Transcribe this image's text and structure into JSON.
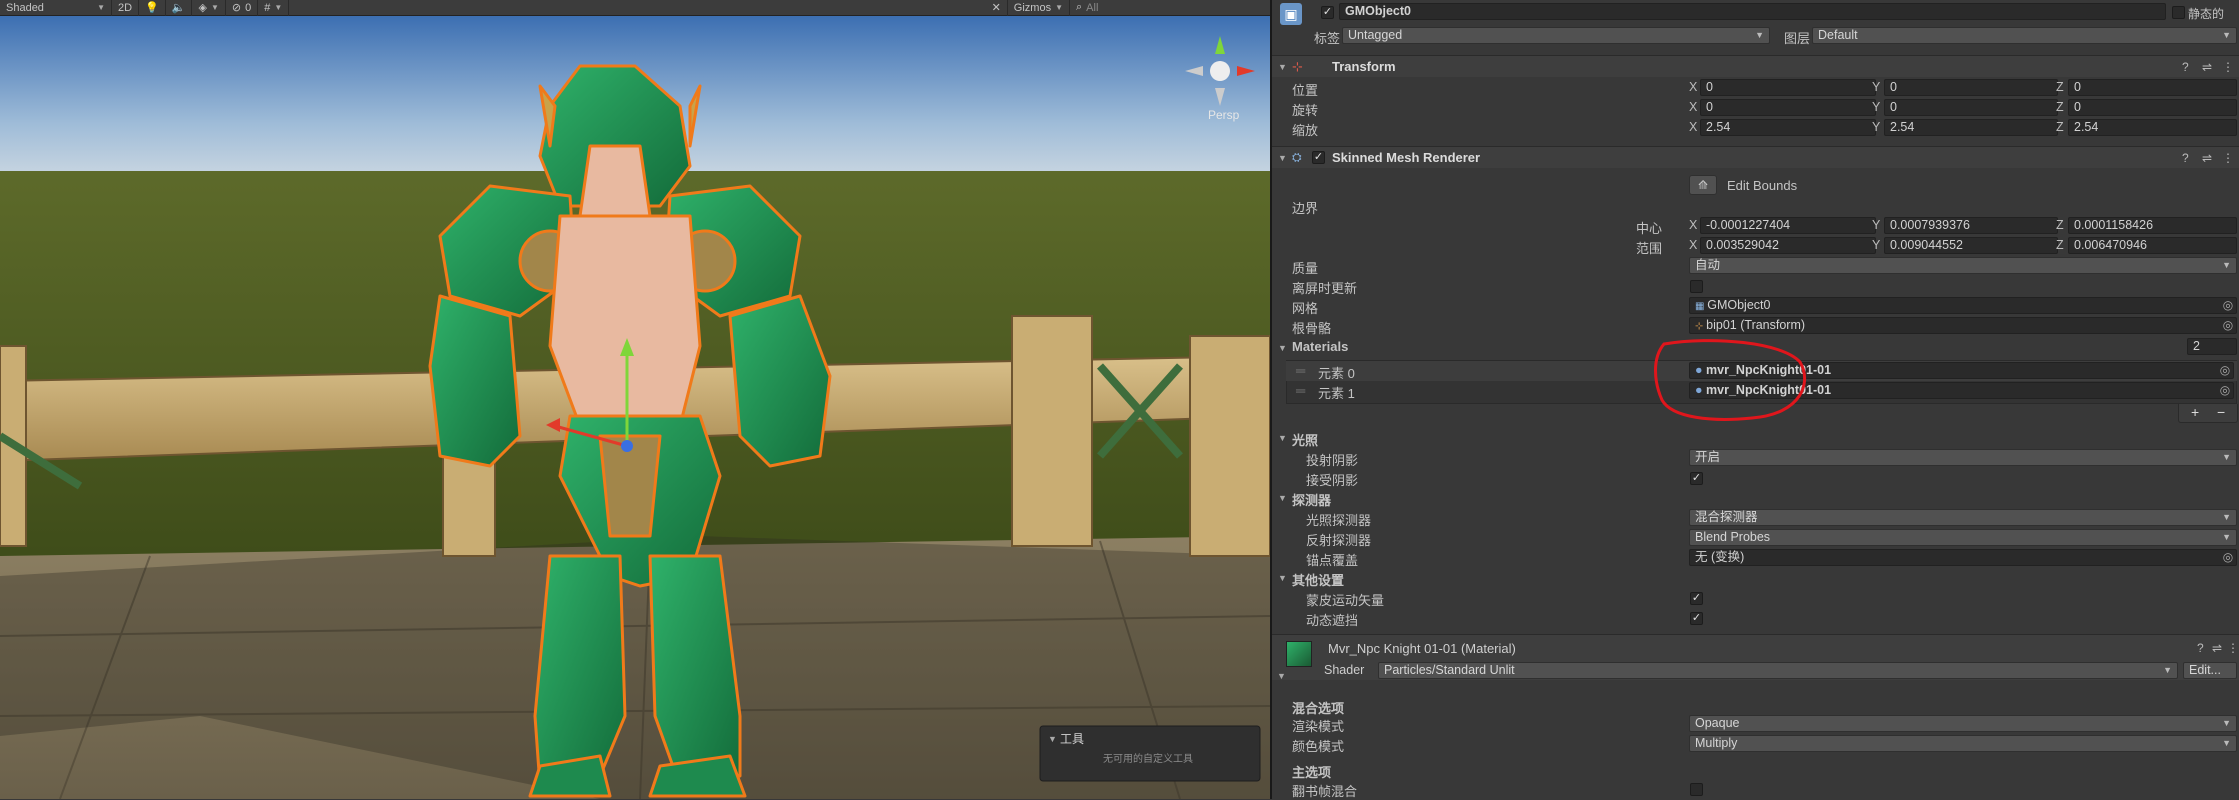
{
  "scene_toolbar": {
    "shading_mode": "Shaded",
    "mode_2d": "2D",
    "fx_count": "0",
    "gizmos": "Gizmos",
    "search_placeholder": "All"
  },
  "scene_view": {
    "persp_label": "Persp",
    "tools_panel_title": "工具",
    "tools_panel_message": "无可用的自定义工具"
  },
  "inspector": {
    "object_name": "GMObject0",
    "static_label": "静态的",
    "tag_label": "标签",
    "tag_value": "Untagged",
    "layer_label": "图层",
    "layer_value": "Default",
    "transform": {
      "title": "Transform",
      "position_label": "位置",
      "rotation_label": "旋转",
      "scale_label": "缩放",
      "position": {
        "x": "0",
        "y": "0",
        "z": "0"
      },
      "rotation": {
        "x": "0",
        "y": "0",
        "z": "0"
      },
      "scale": {
        "x": "2.54",
        "y": "2.54",
        "z": "2.54"
      }
    },
    "renderer": {
      "title": "Skinned Mesh Renderer",
      "edit_bounds": "Edit Bounds",
      "bounds_label": "边界",
      "center_label": "中心",
      "extent_label": "范围",
      "center": {
        "x": "-0.0001227404",
        "y": "0.0007939376",
        "z": "0.0001158426"
      },
      "extent": {
        "x": "0.003529042",
        "y": "0.009044552",
        "z": "0.006470946"
      },
      "quality_label": "质量",
      "quality_value": "自动",
      "offscreen_label": "离屏时更新",
      "mesh_label": "网格",
      "mesh_value": "GMObject0",
      "root_bone_label": "根骨骼",
      "root_bone_value": "bip01 (Transform)",
      "materials_label": "Materials",
      "materials_count": "2",
      "materials": [
        {
          "label": "元素 0",
          "value": "mvr_NpcKnight01-01"
        },
        {
          "label": "元素 1",
          "value": "mvr_NpcKnight01-01"
        }
      ],
      "lighting_label": "光照",
      "cast_shadows_label": "投射阴影",
      "cast_shadows_value": "开启",
      "receive_shadows_label": "接受阴影",
      "probes_label": "探测器",
      "light_probes_label": "光照探测器",
      "light_probes_value": "混合探测器",
      "reflection_probes_label": "反射探测器",
      "reflection_probes_value": "Blend Probes",
      "anchor_override_label": "锚点覆盖",
      "anchor_override_value": "无 (变换)",
      "other_label": "其他设置",
      "skinned_motion_label": "蒙皮运动矢量",
      "dynamic_occlusion_label": "动态遮挡"
    },
    "material": {
      "title": "Mvr_Npc Knight 01-01 (Material)",
      "shader_label": "Shader",
      "shader_value": "Particles/Standard Unlit",
      "edit_button": "Edit...",
      "blend_options_label": "混合选项",
      "render_mode_label": "渲染模式",
      "render_mode_value": "Opaque",
      "color_mode_label": "颜色模式",
      "color_mode_value": "Multiply",
      "main_options_label": "主选项",
      "flipbook_label": "翻书帧混合"
    }
  },
  "colors": {
    "highlight_circle": "#e0161c",
    "selection_outline": "#f07a1a",
    "armor": "#1e8a4e"
  }
}
